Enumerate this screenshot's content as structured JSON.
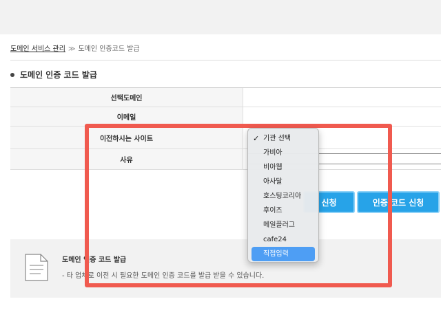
{
  "breadcrumb": {
    "parent": "도메인 서비스 관리",
    "separator": "≫",
    "current": "도메인 인증코드 발급"
  },
  "section": {
    "title": "도메인 인증 코드 발급"
  },
  "form": {
    "rows": [
      {
        "label": "선택도메인"
      },
      {
        "label": "이메일"
      },
      {
        "label": "이전하시는 사이트"
      },
      {
        "label": "사유"
      }
    ]
  },
  "dropdown": {
    "check_mark": "✓",
    "options": [
      "기관 선택",
      "가비아",
      "비아웹",
      "아사달",
      "호스팅코리아",
      "후이즈",
      "메일플러그",
      "cafe24",
      "직접입력"
    ],
    "checked_option": "기관 선택",
    "highlighted_option": "직접입력"
  },
  "buttons": {
    "apply_label": "신청",
    "auth_code_label": "인증 코드 신청"
  },
  "info": {
    "title": "도메인 인증 코드 발급",
    "description": "- 타 업체로 이전 시 필요한 도메인 인증 코드를 발급 받을 수 있습니다."
  },
  "colors": {
    "highlight_border": "#f05a4f",
    "button_blue": "#27a3e8",
    "dropdown_selected": "#4e9ef4"
  }
}
